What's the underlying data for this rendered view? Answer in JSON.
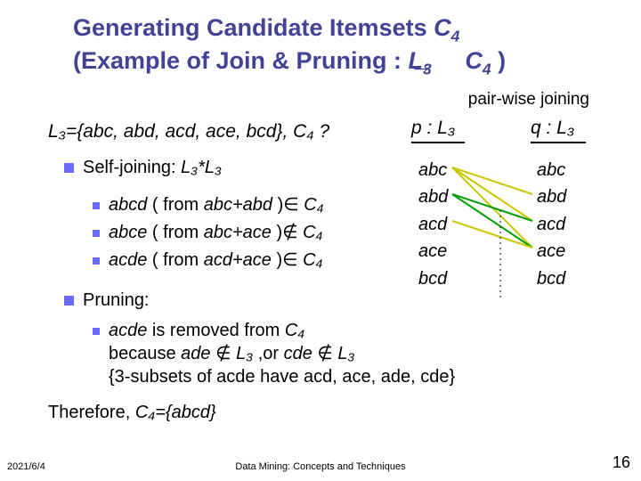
{
  "title": {
    "line1a": "Generating Candidate Itemsets ",
    "line1b": "C",
    "line1bsub": "4",
    "line2a": "(Example of Join & Pruning : ",
    "line2b": "L",
    "line2bsub": "3",
    "line2c": " ",
    "line2d": "C",
    "line2dsub": "4",
    "line2e": " )"
  },
  "arrow_glyph": "→",
  "pairwise": "pair-wise joining",
  "l3set": "L₃={abc, abd, acd, ace, bcd}, C₄  ?",
  "p_label": "p : L₃",
  "q_label": "q : L₃",
  "selfjoin_label": "Self-joining: ",
  "selfjoin_expr": "L₃*L₃",
  "joins": [
    {
      "cand": "abcd",
      "mid": "  ( from ",
      "from": "abc+abd",
      "tail": " )∈ ",
      "set": "C₄"
    },
    {
      "cand": "abce",
      "mid": "  ( from ",
      "from": "abc+ace",
      "tail": " )∉ ",
      "set": "C₄"
    },
    {
      "cand": "acde",
      "mid": "  ( from ",
      "from": "acd+ace",
      "tail": " )∈ ",
      "set": "C₄"
    }
  ],
  "pruning_label": "Pruning:",
  "prune": {
    "l1a": "acde",
    "l1b": " is removed from ",
    "l1c": "C₄",
    "l2a": "because ",
    "l2b": "ade",
    "l2c": " ∉ ",
    "l2d": "L₃",
    "l2e": " ,or ",
    "l2f": "cde",
    "l2g": " ∉ ",
    "l2h": "L₃",
    "l3": "{3-subsets of acde have acd, ace, ade, cde}"
  },
  "therefore_a": "Therefore, ",
  "therefore_b": "C₄={abcd}",
  "col_p": [
    "abc",
    "abd",
    "acd",
    "ace",
    "bcd"
  ],
  "col_q": [
    "abc",
    "abd",
    "acd",
    "ace",
    "bcd"
  ],
  "footer": {
    "date": "2021/6/4",
    "center": "Data Mining: Concepts and Techniques",
    "page": "16"
  },
  "colors": {
    "title": "#424296",
    "bullet": "#6b6bff"
  }
}
